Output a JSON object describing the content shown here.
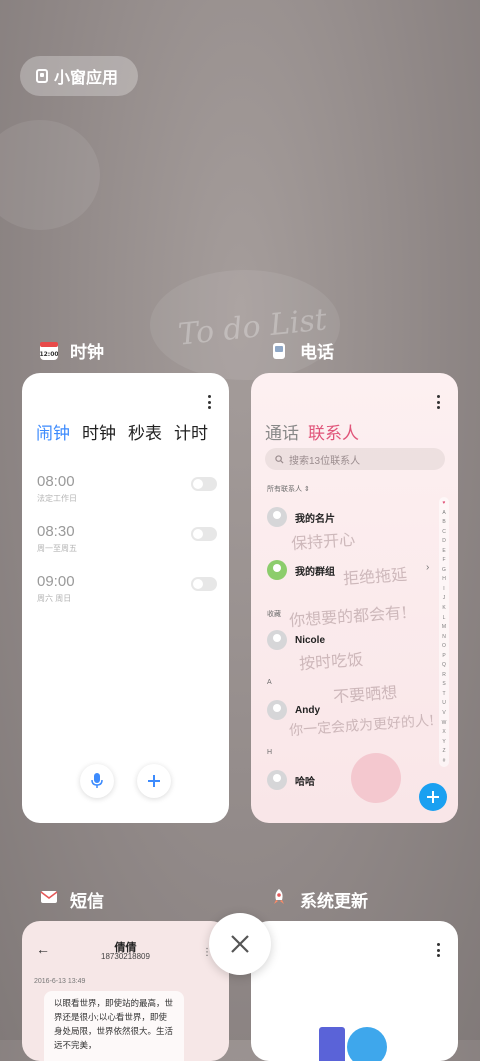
{
  "top_button": {
    "label": "小窗应用",
    "icon": "small-window-icon"
  },
  "wallpaper_text": "To do List",
  "apps": {
    "clock": {
      "label": "时钟",
      "icon": "clock-icon",
      "tabs": [
        "闹钟",
        "时钟",
        "秒表",
        "计时"
      ],
      "alarms": [
        {
          "time": "08:00",
          "sub": "法定工作日"
        },
        {
          "time": "08:30",
          "sub": "周一至周五"
        },
        {
          "time": "09:00",
          "sub": "周六 周日"
        }
      ]
    },
    "phone": {
      "label": "电话",
      "icon": "phone-icon",
      "tabs": [
        "通话",
        "联系人"
      ],
      "search_placeholder": "搜索13位联系人",
      "filter": "所有联系人",
      "my_card": "我的名片",
      "my_groups": "我的群组",
      "section_fav": "收藏",
      "section_a": "A",
      "section_h": "H",
      "contacts": [
        "Nicole",
        "Andy",
        "哈哈"
      ],
      "alphabet": [
        "♥",
        "A",
        "B",
        "C",
        "D",
        "E",
        "F",
        "G",
        "H",
        "I",
        "J",
        "K",
        "L",
        "M",
        "N",
        "O",
        "P",
        "Q",
        "R",
        "S",
        "T",
        "U",
        "V",
        "W",
        "X",
        "Y",
        "Z",
        "#"
      ],
      "doodles": [
        "保持开心",
        "拒绝拖延",
        "你想要的都会有!",
        "按时吃饭",
        "不要晒想",
        "你一定会成为更好的人!"
      ]
    },
    "sms": {
      "label": "短信",
      "icon": "mail-icon",
      "contact_name": "倩倩",
      "contact_number": "18730218809",
      "date": "2016-6-13 13:49",
      "message": "以眼看世界，即使站的最高，世界还是很小;以心看世界，即使身处局限，世界依然很大。生活远不完美，"
    },
    "update": {
      "label": "系统更新",
      "icon": "rocket-icon"
    }
  },
  "colors": {
    "accent_blue": "#3d8bfd",
    "accent_pink": "#e0557a",
    "fab_blue": "#1aa0f1"
  }
}
